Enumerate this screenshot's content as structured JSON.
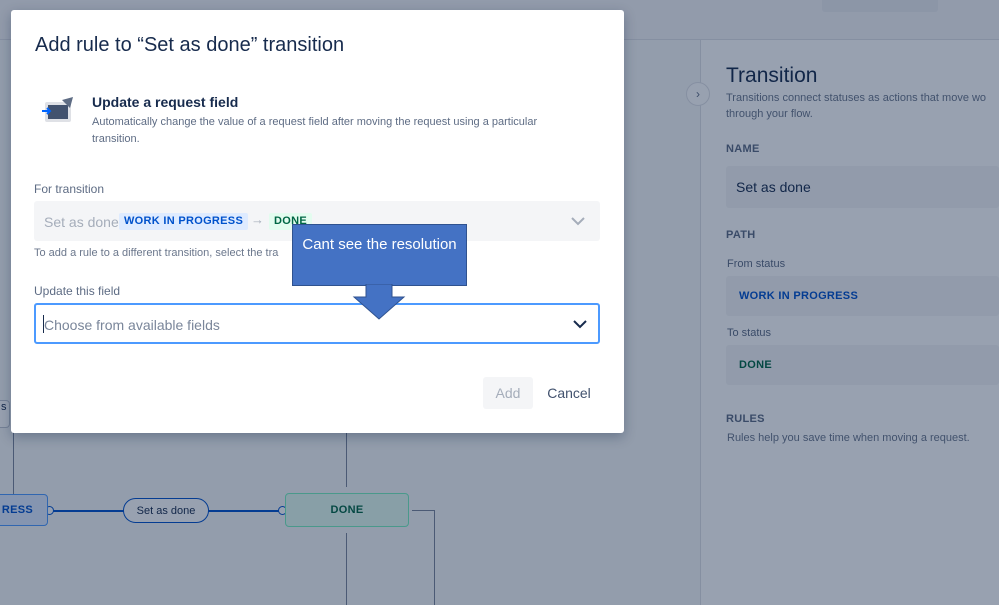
{
  "modal": {
    "title": "Add rule to “Set as done” transition",
    "rule": {
      "icon": "update-field-icon",
      "title": "Update a request field",
      "description": "Automatically change the value of a request field after moving the request using a particular transition."
    },
    "for_transition": {
      "label": "For transition",
      "name": "Set as done",
      "from_status": "WORK IN PROGRESS",
      "to_status": "DONE",
      "helper": "To add a rule to a different transition, select the tra"
    },
    "update_field": {
      "label": "Update this field",
      "placeholder": "Choose from available fields"
    },
    "buttons": {
      "add": "Add",
      "cancel": "Cancel"
    }
  },
  "callout": {
    "text": "Cant see the resolution"
  },
  "side_panel": {
    "title": "Transition",
    "description": "Transitions connect statuses as actions that move wo through your flow.",
    "name_label": "NAME",
    "name_value": "Set as done",
    "path_label": "PATH",
    "from_label": "From status",
    "from_value": "WORK IN PROGRESS",
    "to_label": "To status",
    "to_value": "DONE",
    "rules_label": "RULES",
    "rules_description": "Rules help you save time when moving a request."
  },
  "canvas": {
    "stub_label": "s",
    "progress_node": "RESS",
    "transition_pill": "Set as done",
    "done_node": "DONE"
  },
  "colors": {
    "overlay": "#091e42",
    "primary": "#0052cc",
    "focus": "#4c9aff",
    "done_bg": "#e3fcef",
    "done_text": "#006644",
    "progress_bg": "#deebff",
    "callout": "#4472c4"
  }
}
